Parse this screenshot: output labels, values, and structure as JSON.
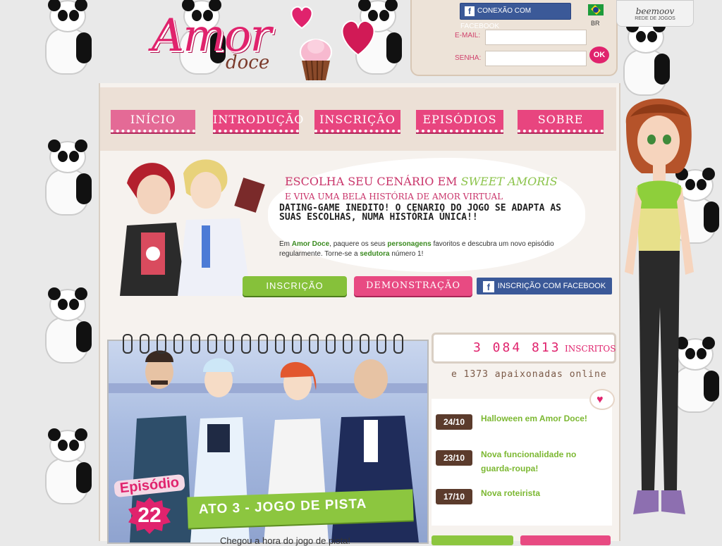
{
  "header": {
    "logo_main": "Amor",
    "logo_sub": "doce",
    "facebook_connect": "CONEXÃO COM FACEBOOK",
    "locale": "BR",
    "email_label": "E-MAIL:",
    "password_label": "SENHA:",
    "email_value": "",
    "password_value": "",
    "ok_label": "OK",
    "network_logo": "beemoov",
    "network_label": "REDE DE JOGOS"
  },
  "nav": [
    {
      "label": "INÍCIO",
      "active": true
    },
    {
      "label": "INTRODUÇÃO",
      "active": false
    },
    {
      "label": "INSCRIÇÃO",
      "active": false
    },
    {
      "label": "EPISÓDIOS",
      "active": false
    },
    {
      "label": "SOBRE",
      "active": false
    }
  ],
  "hero": {
    "title_prefix": "ESCOLHA SEU CENÁRIO EM",
    "title_highlight": "SWEET AMORIS",
    "subtitle": "E VIVA UMA BELA HISTÓRIA DE AMOR VIRTUAL",
    "bold_text": "DATING-GAME INEDITO! O CENARIO DO JOGO SE ADAPTA AS SUAS ESCOLHAS, NUMA HISTÓRIA ÚNICA!!",
    "desc_1": "Em",
    "desc_brand": "Amor Doce",
    "desc_2": ", paquere os seus",
    "desc_chars": "personagens",
    "desc_3": "favoritos e descubra um novo episódio regularmente. Torne-se a",
    "desc_role": "sedutora",
    "desc_4": "número 1!"
  },
  "cta": {
    "signup": "INSCRIÇÃO",
    "demo": "DEMONSTRAÇÃO",
    "facebook_signup": "INSCRIÇÃO COM FACEBOOK"
  },
  "episode": {
    "label": "Episódio",
    "number": "22",
    "title": "ATO 3 - JOGO DE PISTA",
    "caption": "Chegou a hora do jogo de pista!"
  },
  "stats": {
    "count": "3 084 813",
    "count_label": "INSCRITOS",
    "online_text": "e 1373 apaixonadas online"
  },
  "news": [
    {
      "date": "24/10",
      "title": "Halloween em Amor Doce!"
    },
    {
      "date": "23/10",
      "title": "Nova funcionalidade no guarda-roupa!"
    },
    {
      "date": "17/10",
      "title": "Nova roteirista"
    }
  ],
  "colors": {
    "brand_pink": "#e0236d",
    "accent_green": "#8cc63f",
    "facebook_blue": "#3b5998",
    "date_brown": "#5b3b2c"
  },
  "icons": {
    "facebook": "facebook-icon",
    "flag": "brazil-flag-icon",
    "heart": "heart-icon",
    "cupcake": "cupcake-icon"
  }
}
